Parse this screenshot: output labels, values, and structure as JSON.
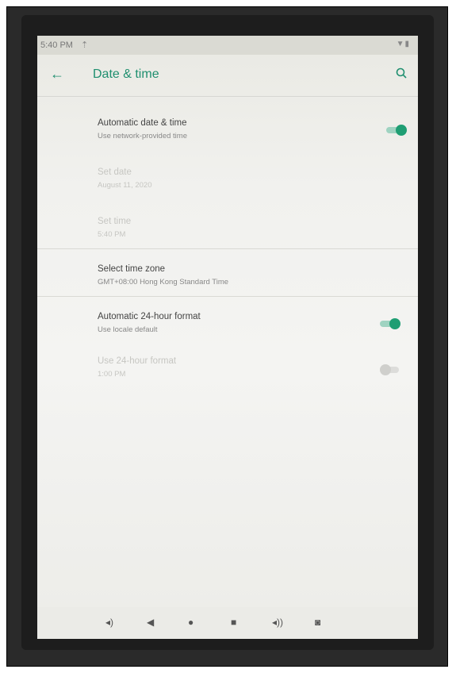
{
  "status_bar": {
    "time": "5:40 PM",
    "upload_icon": "upload-icon",
    "right_icons": "wifi-icon battery-icon"
  },
  "app_bar": {
    "title": "Date & time",
    "back_icon": "back-arrow-icon",
    "search_icon": "search-icon"
  },
  "settings": [
    {
      "label": "Automatic date & time",
      "sub": "Use network-provided time",
      "enabled": true,
      "toggle": "on"
    },
    {
      "label": "Set date",
      "sub": "August 11, 2020",
      "enabled": false
    },
    {
      "label": "Set time",
      "sub": "5:40 PM",
      "enabled": false
    },
    {
      "label": "Select time zone",
      "sub": "GMT+08:00 Hong Kong Standard Time",
      "enabled": true
    },
    {
      "label": "Automatic 24-hour format",
      "sub": "Use locale default",
      "enabled": true,
      "toggle": "on"
    },
    {
      "label": "Use 24-hour format",
      "sub": "1:00 PM",
      "enabled": false,
      "toggle": "off"
    }
  ],
  "nav_bar": {
    "icons": [
      "volume-down-icon",
      "back-icon",
      "home-icon",
      "recents-icon",
      "volume-up-icon",
      "camera-icon"
    ]
  },
  "colors": {
    "accent": "#1f8f6f",
    "toggle_on": "#1f9e73"
  }
}
